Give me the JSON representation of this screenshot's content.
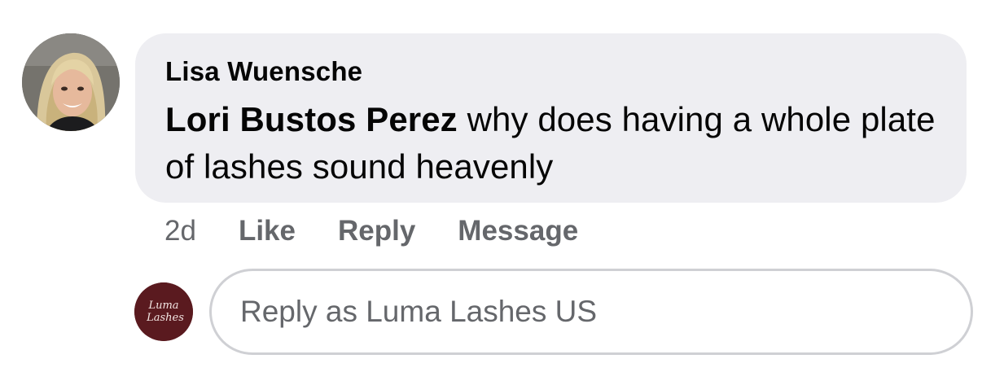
{
  "comment": {
    "author_name": "Lisa Wuensche",
    "mention": "Lori Bustos Perez",
    "text": "why does having a whole plate of lashes sound heavenly",
    "avatar_icon": "user-photo-avatar"
  },
  "actions": {
    "timestamp": "2d",
    "like_label": "Like",
    "reply_label": "Reply",
    "message_label": "Message"
  },
  "reply_composer": {
    "page_avatar_text": "Luma Lashes",
    "page_avatar_color": "#5a1a1f",
    "placeholder": "Reply as Luma Lashes US"
  },
  "colors": {
    "bubble_background": "#eeeef2",
    "secondary_text": "#65676b",
    "input_border": "#cfd0d4"
  }
}
